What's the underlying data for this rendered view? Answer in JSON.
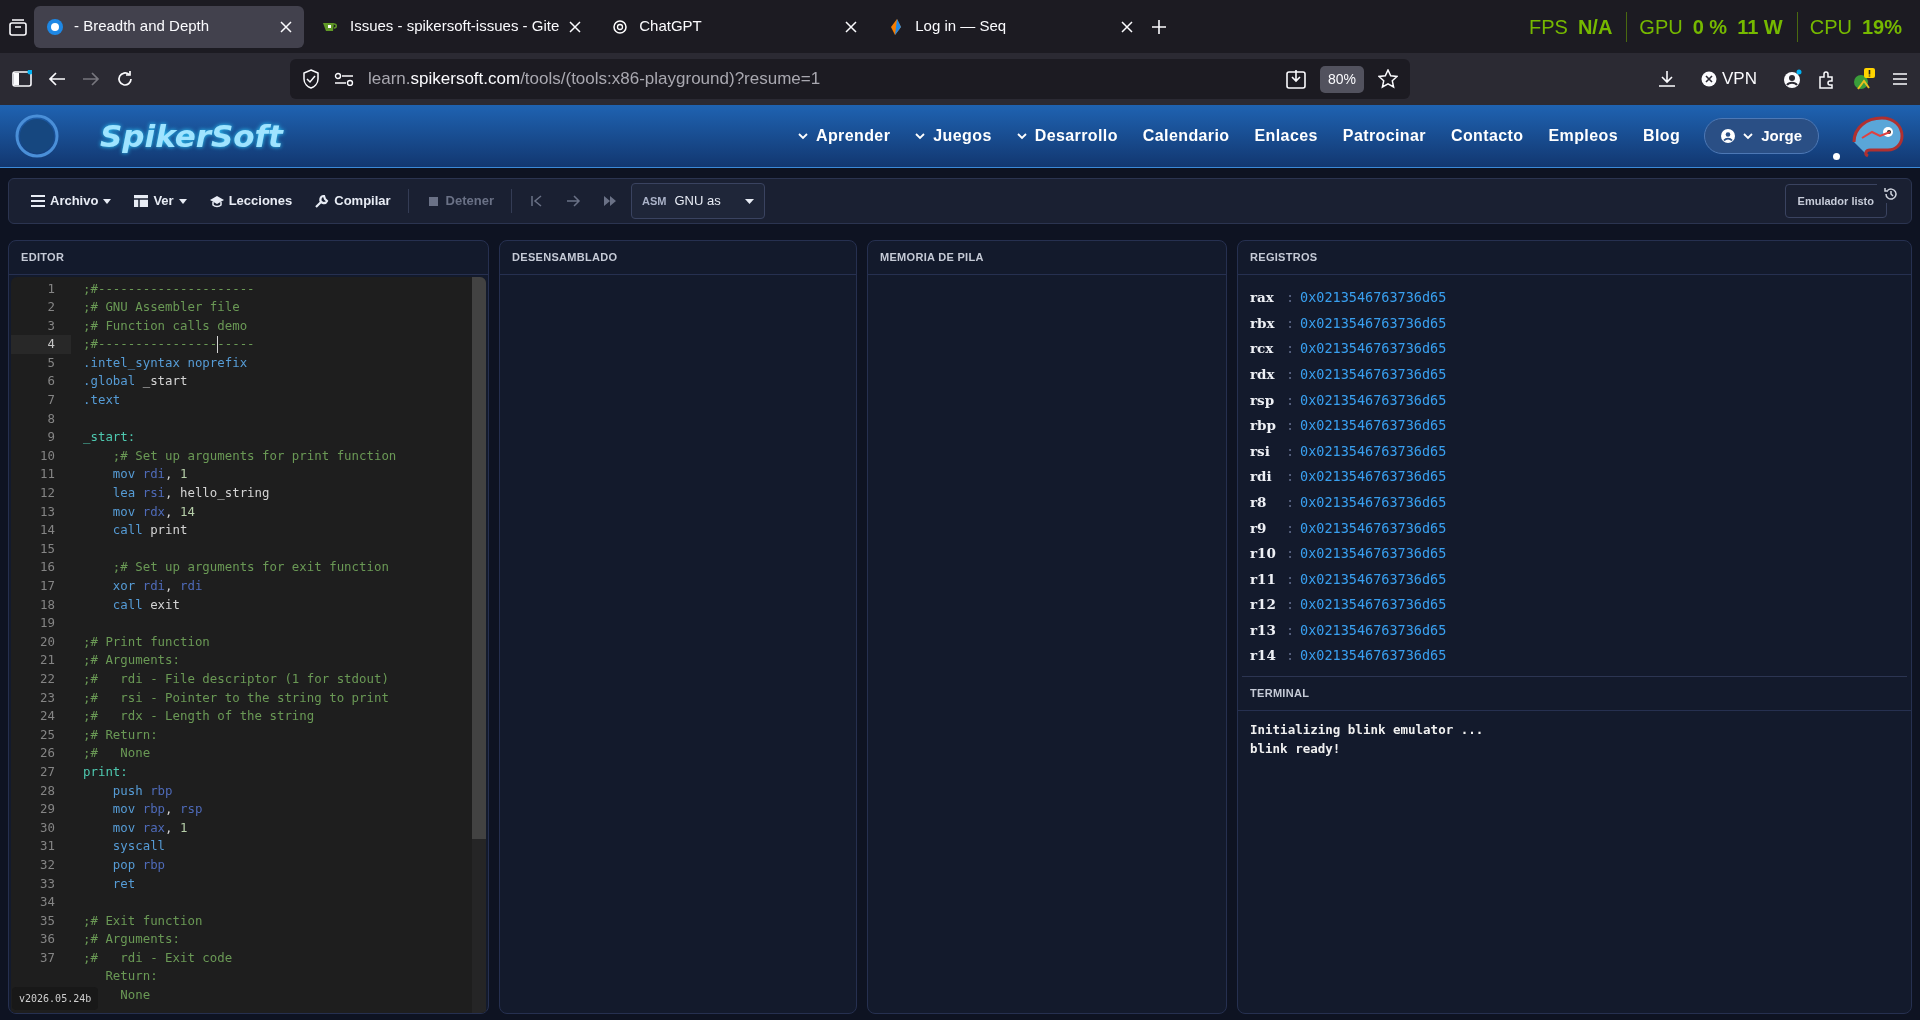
{
  "browser": {
    "tabs": [
      {
        "kind": "spikersoft",
        "title": "- Breadth and Depth",
        "selected": true
      },
      {
        "kind": "gitea",
        "title": "Issues - spikersoft-issues - Gite",
        "selected": false
      },
      {
        "kind": "chatgpt",
        "title": "ChatGPT",
        "selected": false
      },
      {
        "kind": "seq",
        "title": "Log in — Seq",
        "selected": false
      }
    ],
    "overlay": [
      {
        "label": "FPS",
        "values": [
          "N/A"
        ]
      },
      {
        "label": "GPU",
        "values": [
          "0 %",
          "11 W"
        ]
      },
      {
        "label": "CPU",
        "values": [
          "19%"
        ]
      }
    ],
    "url": [
      {
        "text": "learn.",
        "emphasis": false
      },
      {
        "text": "spikersoft.com",
        "emphasis": true
      },
      {
        "text": "/tools/(tools:x86-playground)?resume=1",
        "emphasis": false
      }
    ],
    "zoom": "80%",
    "vpn": "VPN"
  },
  "site": {
    "logo": "SpikerSoft",
    "nav": [
      {
        "label": "Aprender",
        "dropdown": true
      },
      {
        "label": "Juegos",
        "dropdown": true
      },
      {
        "label": "Desarrollo",
        "dropdown": true
      },
      {
        "label": "Calendario",
        "dropdown": false
      },
      {
        "label": "Enlaces",
        "dropdown": false
      },
      {
        "label": "Patrocinar",
        "dropdown": false
      },
      {
        "label": "Contacto",
        "dropdown": false
      },
      {
        "label": "Empleos",
        "dropdown": false
      },
      {
        "label": "Blog",
        "dropdown": false
      }
    ],
    "user": "Jorge"
  },
  "toolbar": {
    "items": [
      {
        "kind": "menu",
        "label": "Archivo",
        "dropdown": true,
        "disabled": false
      },
      {
        "kind": "grid",
        "label": "Ver",
        "dropdown": true,
        "disabled": false
      },
      {
        "kind": "cap",
        "label": "Lecciones",
        "dropdown": false,
        "disabled": false
      },
      {
        "kind": "wrench",
        "label": "Compilar",
        "dropdown": false,
        "disabled": false
      },
      {
        "kind": "divider"
      },
      {
        "kind": "stop",
        "label": "Detener",
        "dropdown": false,
        "disabled": true
      },
      {
        "kind": "divider"
      },
      {
        "kind": "first",
        "dropdown": false,
        "disabled": true
      },
      {
        "kind": "step",
        "dropdown": false,
        "disabled": true
      },
      {
        "kind": "forward",
        "dropdown": false,
        "disabled": true
      }
    ],
    "assembler": {
      "prefix": "ASM",
      "value": "GNU as"
    },
    "status": "Emulador listo"
  },
  "editor": {
    "title": "EDITOR",
    "version": "v2026.05.24b",
    "lines": [
      {
        "num": "1",
        "active": false,
        "tokens": [
          {
            "kind": "comment",
            "text": ";#---------------------"
          }
        ]
      },
      {
        "num": "2",
        "active": false,
        "tokens": [
          {
            "kind": "comment",
            "text": ";# GNU Assembler file"
          }
        ]
      },
      {
        "num": "3",
        "active": false,
        "tokens": [
          {
            "kind": "comment",
            "text": ";# Function calls demo"
          }
        ]
      },
      {
        "num": "4",
        "active": true,
        "tokens": [
          {
            "kind": "comment",
            "text": ";#---------------------"
          }
        ]
      },
      {
        "num": "5",
        "active": false,
        "tokens": [
          {
            "kind": "directive",
            "text": ".intel_syntax noprefix"
          }
        ]
      },
      {
        "num": "6",
        "active": false,
        "tokens": [
          {
            "kind": "directive",
            "text": ".global"
          },
          {
            "kind": "plain",
            "text": " _start"
          }
        ]
      },
      {
        "num": "7",
        "active": false,
        "tokens": [
          {
            "kind": "directive",
            "text": ".text"
          }
        ]
      },
      {
        "num": "8",
        "active": false
      },
      {
        "num": "9",
        "active": false,
        "tokens": [
          {
            "kind": "label",
            "text": "_start:"
          }
        ]
      },
      {
        "num": "10",
        "active": false,
        "tokens": [
          {
            "kind": "comment",
            "text": "    ;# Set up arguments for print function"
          }
        ]
      },
      {
        "num": "11",
        "active": false,
        "tokens": [
          {
            "kind": "instruction",
            "text": "    mov"
          },
          {
            "kind": "register",
            "text": " rdi"
          },
          {
            "kind": "plain",
            "text": ", "
          },
          {
            "kind": "number",
            "text": "1"
          }
        ]
      },
      {
        "num": "12",
        "active": false,
        "tokens": [
          {
            "kind": "instruction",
            "text": "    lea"
          },
          {
            "kind": "register",
            "text": " rsi"
          },
          {
            "kind": "plain",
            "text": ", hello_string"
          }
        ]
      },
      {
        "num": "13",
        "active": false,
        "tokens": [
          {
            "kind": "instruction",
            "text": "    mov"
          },
          {
            "kind": "register",
            "text": " rdx"
          },
          {
            "kind": "plain",
            "text": ", "
          },
          {
            "kind": "number",
            "text": "14"
          }
        ]
      },
      {
        "num": "14",
        "active": false,
        "tokens": [
          {
            "kind": "instruction",
            "text": "    call"
          },
          {
            "kind": "plain",
            "text": " print"
          }
        ]
      },
      {
        "num": "15",
        "active": false
      },
      {
        "num": "16",
        "active": false,
        "tokens": [
          {
            "kind": "comment",
            "text": "    ;# Set up arguments for exit function"
          }
        ]
      },
      {
        "num": "17",
        "active": false,
        "tokens": [
          {
            "kind": "instruction",
            "text": "    xor"
          },
          {
            "kind": "register",
            "text": " rdi"
          },
          {
            "kind": "plain",
            "text": ", "
          },
          {
            "kind": "register",
            "text": "rdi"
          }
        ]
      },
      {
        "num": "18",
        "active": false,
        "tokens": [
          {
            "kind": "instruction",
            "text": "    call"
          },
          {
            "kind": "plain",
            "text": " exit"
          }
        ]
      },
      {
        "num": "19",
        "active": false
      },
      {
        "num": "20",
        "active": false,
        "tokens": [
          {
            "kind": "comment",
            "text": ";# Print function"
          }
        ]
      },
      {
        "num": "21",
        "active": false,
        "tokens": [
          {
            "kind": "comment",
            "text": ";# Arguments:"
          }
        ]
      },
      {
        "num": "22",
        "active": false,
        "tokens": [
          {
            "kind": "comment",
            "text": ";#   rdi - File descriptor (1 for stdout)"
          }
        ]
      },
      {
        "num": "23",
        "active": false,
        "tokens": [
          {
            "kind": "comment",
            "text": ";#   rsi - Pointer to the string to print"
          }
        ]
      },
      {
        "num": "24",
        "active": false,
        "tokens": [
          {
            "kind": "comment",
            "text": ";#   rdx - Length of the string"
          }
        ]
      },
      {
        "num": "25",
        "active": false,
        "tokens": [
          {
            "kind": "comment",
            "text": ";# Return:"
          }
        ]
      },
      {
        "num": "26",
        "active": false,
        "tokens": [
          {
            "kind": "comment",
            "text": ";#   None"
          }
        ]
      },
      {
        "num": "27",
        "active": false,
        "tokens": [
          {
            "kind": "label",
            "text": "print:"
          }
        ]
      },
      {
        "num": "28",
        "active": false,
        "tokens": [
          {
            "kind": "instruction",
            "text": "    push"
          },
          {
            "kind": "register",
            "text": " rbp"
          }
        ]
      },
      {
        "num": "29",
        "active": false,
        "tokens": [
          {
            "kind": "instruction",
            "text": "    mov"
          },
          {
            "kind": "register",
            "text": " rbp"
          },
          {
            "kind": "plain",
            "text": ", "
          },
          {
            "kind": "register",
            "text": "rsp"
          }
        ]
      },
      {
        "num": "30",
        "active": false,
        "tokens": [
          {
            "kind": "instruction",
            "text": "    mov"
          },
          {
            "kind": "register",
            "text": " rax"
          },
          {
            "kind": "plain",
            "text": ", "
          },
          {
            "kind": "number",
            "text": "1"
          }
        ]
      },
      {
        "num": "31",
        "active": false,
        "tokens": [
          {
            "kind": "instruction",
            "text": "    syscall"
          }
        ]
      },
      {
        "num": "32",
        "active": false,
        "tokens": [
          {
            "kind": "instruction",
            "text": "    pop"
          },
          {
            "kind": "register",
            "text": " rbp"
          }
        ]
      },
      {
        "num": "33",
        "active": false,
        "tokens": [
          {
            "kind": "instruction",
            "text": "    ret"
          }
        ]
      },
      {
        "num": "34",
        "active": false
      },
      {
        "num": "35",
        "active": false,
        "tokens": [
          {
            "kind": "comment",
            "text": ";# Exit function"
          }
        ]
      },
      {
        "num": "36",
        "active": false,
        "tokens": [
          {
            "kind": "comment",
            "text": ";# Arguments:"
          }
        ]
      },
      {
        "num": "37",
        "active": false,
        "tokens": [
          {
            "kind": "comment",
            "text": ";#   rdi - Exit code"
          }
        ]
      },
      {
        "tokens": [
          {
            "kind": "comment",
            "text": "   Return:"
          }
        ]
      },
      {
        "tokens": [
          {
            "kind": "comment",
            "text": "     None"
          }
        ]
      }
    ]
  },
  "disassembly": {
    "title": "DESENSAMBLADO"
  },
  "stack": {
    "title": "MEMORIA DE PILA"
  },
  "registers": {
    "title": "REGISTROS",
    "rows": [
      {
        "name": "rax",
        "separator": ":",
        "value": "0x0213546763736d65"
      },
      {
        "name": "rbx",
        "separator": ":",
        "value": "0x0213546763736d65"
      },
      {
        "name": "rcx",
        "separator": ":",
        "value": "0x0213546763736d65"
      },
      {
        "name": "rdx",
        "separator": ":",
        "value": "0x0213546763736d65"
      },
      {
        "name": "rsp",
        "separator": ":",
        "value": "0x0213546763736d65"
      },
      {
        "name": "rbp",
        "separator": ":",
        "value": "0x0213546763736d65"
      },
      {
        "name": "rsi",
        "separator": ":",
        "value": "0x0213546763736d65"
      },
      {
        "name": "rdi",
        "separator": ":",
        "value": "0x0213546763736d65"
      },
      {
        "name": "r8",
        "separator": ":",
        "value": "0x0213546763736d65"
      },
      {
        "name": "r9",
        "separator": ":",
        "value": "0x0213546763736d65"
      },
      {
        "name": "r10",
        "separator": ":",
        "value": "0x0213546763736d65"
      },
      {
        "name": "r11",
        "separator": ":",
        "value": "0x0213546763736d65"
      },
      {
        "name": "r12",
        "separator": ":",
        "value": "0x0213546763736d65"
      },
      {
        "name": "r13",
        "separator": ":",
        "value": "0x0213546763736d65"
      },
      {
        "name": "r14",
        "separator": ":",
        "value": "0x0213546763736d65"
      }
    ]
  },
  "terminal": {
    "title": "TERMINAL",
    "lines": [
      "Initializing blink emulator ...",
      "blink ready!"
    ]
  }
}
